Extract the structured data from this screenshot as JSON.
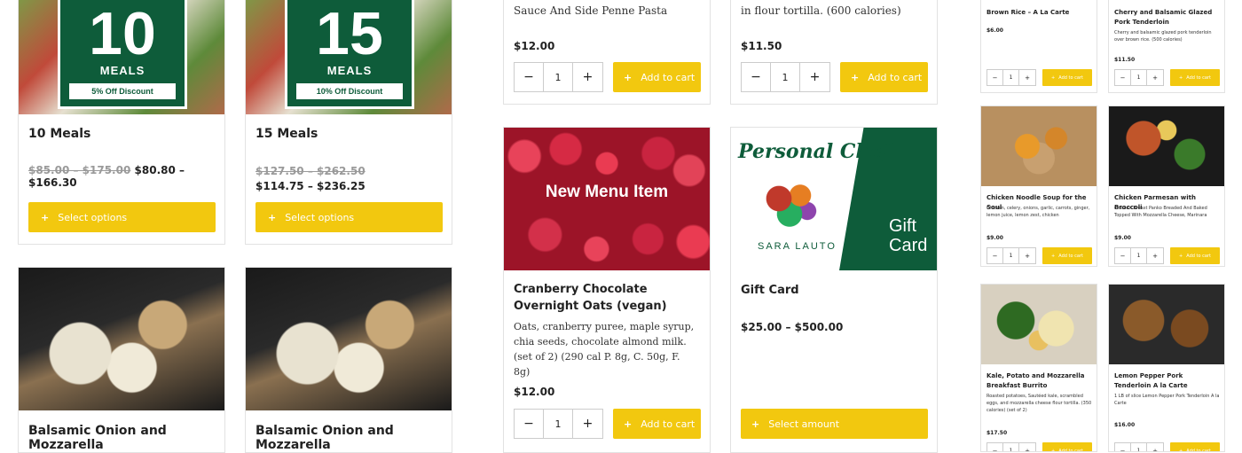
{
  "meal_packs": [
    {
      "number": "10",
      "word": "MEALS",
      "discount": "5% Off Discount",
      "title": "10 Meals",
      "old_price": "$85.00 – $175.00",
      "new_price": "$80.80 – $166.30",
      "button": "Select options"
    },
    {
      "number": "15",
      "word": "MEALS",
      "discount": "10% Off Discount",
      "title": "15 Meals",
      "old_price": "$127.50 – $262.50",
      "new_price": "$114.75 – $236.25",
      "button": "Select options"
    }
  ],
  "bottom_left": [
    {
      "title": "Balsamic Onion and Mozzarella"
    },
    {
      "title": "Balsamic Onion and Mozzarella"
    }
  ],
  "middle": {
    "top_left": {
      "desc": "Sauce And Side Penne Pasta",
      "price": "$12.00",
      "qty": "1",
      "button": "Add to cart"
    },
    "top_right": {
      "desc": "in flour tortilla. (600 calories)",
      "price": "$11.50",
      "qty": "1",
      "button": "Add to cart"
    },
    "cranberry": {
      "image_label": "New Menu Item",
      "title": "Cranberry Chocolate Overnight Oats (vegan)",
      "desc": "Oats, cranberry puree, maple syrup, chia seeds, chocolate almond milk. (set of 2) (290 cal P. 8g, C. 50g, F. 8g)",
      "price": "$12.00",
      "qty": "1",
      "button": "Add to cart"
    },
    "gift": {
      "script": "Personal Chef",
      "name": "SARA LAUTO",
      "card_text": "Gift Card",
      "title": "Gift Card",
      "price": "$25.00 – $500.00",
      "button": "Select amount"
    }
  },
  "small_cards": [
    {
      "title": "Brown Rice – A La Carte",
      "desc": "",
      "price": "$6.00",
      "qty": "1",
      "button": "Add to cart",
      "img": ""
    },
    {
      "title": "Cherry and Balsamic Glazed Pork Tenderloin",
      "desc": "Cherry and balsamic glazed pork tenderloin over brown rice. (500 calories)",
      "price": "$11.50",
      "qty": "1",
      "button": "Add to cart",
      "img": ""
    },
    {
      "title": "Chicken Noodle Soup for the Soul",
      "desc": "Chicken, celery, onions, garlic, carrots, ginger, lemon juice, lemon zest, chicken",
      "price": "$9.00",
      "qty": "1",
      "button": "Add to cart",
      "img": "soup"
    },
    {
      "title": "Chicken Parmesan with Broccoli",
      "desc": "Chicken Breast Panko Breaded And Baked Topped With Mozzarella Cheese, Marinara",
      "price": "$9.00",
      "qty": "1",
      "button": "Add to cart",
      "img": "parm"
    },
    {
      "title": "Kale, Potato and Mozzarella Breakfast Burrito",
      "desc": "Roasted potatoes, Sautéed kale, scrambled eggs, and mozzarella cheese flour tortilla. (350 calories) (set of 2)",
      "price": "$17.50",
      "qty": "1",
      "button": "Add to cart",
      "img": "burrito"
    },
    {
      "title": "Lemon Pepper Pork Tenderloin A la Carte",
      "desc": "1 LB of slice Lemon Pepper Pork Tenderloin A la Carte",
      "price": "$16.00",
      "qty": "1",
      "button": "Add to cart",
      "img": "lemon"
    }
  ],
  "icons": {
    "minus": "−",
    "plus": "+"
  },
  "colors": {
    "accent": "#f2c80f",
    "brand_green": "#0e5c3a"
  }
}
